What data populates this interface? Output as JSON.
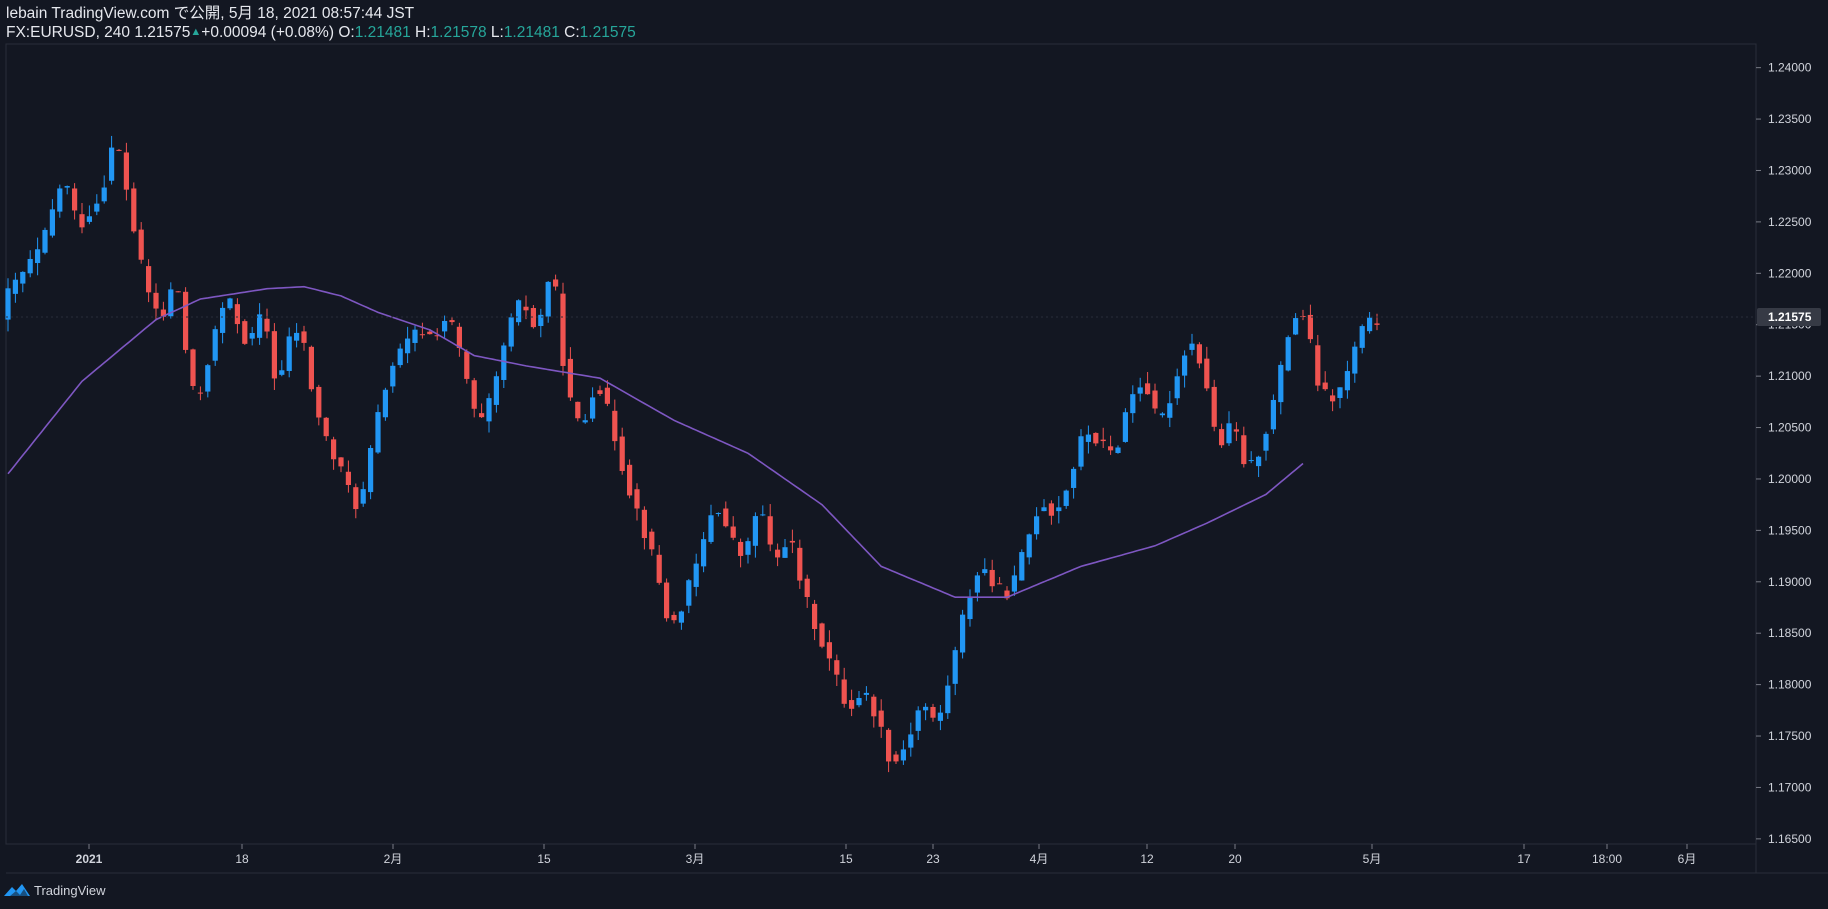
{
  "header": {
    "publisher": "lebain",
    "published_text": "TradingView.com で公開, 5月 18, 2021 08:57:44 JST",
    "symbol": "FX:EURUSD, 240",
    "last": "1.21575",
    "change": "+0.00094 (+0.08%)",
    "o_label": "O:",
    "o_value": "1.21481",
    "h_label": "H:",
    "h_value": "1.21578",
    "l_label": "L:",
    "l_value": "1.21481",
    "c_label": "C:",
    "c_value": "1.21575"
  },
  "footer": {
    "brand": "TradingView"
  },
  "colors": {
    "background": "#131722",
    "up_candle": "#2196f3",
    "down_candle": "#ef5350",
    "moving_average": "#7e57c2",
    "axis_text": "#d1d4dc",
    "price_tag_bg": "#363a45"
  },
  "icons": {
    "footer_logo": "tradingview-logo-icon"
  },
  "chart_data": {
    "type": "candlestick",
    "symbol": "FX:EURUSD",
    "interval": "240",
    "ylim": [
      1.1645,
      1.2423
    ],
    "y_ticks": [
      1.165,
      1.17,
      1.175,
      1.18,
      1.185,
      1.19,
      1.195,
      1.2,
      1.205,
      1.21,
      1.215,
      1.22,
      1.225,
      1.23,
      1.235,
      1.24
    ],
    "y_tick_labels": [
      "1.16500",
      "1.17000",
      "1.17500",
      "1.18000",
      "1.18500",
      "1.19000",
      "1.19500",
      "1.20000",
      "1.20500",
      "1.21000",
      "1.21500",
      "1.22000",
      "1.22500",
      "1.23000",
      "1.23500",
      "1.24000"
    ],
    "x_ticks": [
      "2021",
      "18",
      "2月",
      "15",
      "3月",
      "15",
      "23",
      "4月",
      "12",
      "20",
      "5月",
      "17",
      "18:00",
      "6月"
    ],
    "last_price": 1.21575,
    "last_price_label": "1.21575",
    "price_path": [
      [
        0,
        1.2175
      ],
      [
        5,
        1.2225
      ],
      [
        8,
        1.2295
      ],
      [
        10,
        1.2245
      ],
      [
        13,
        1.2275
      ],
      [
        15,
        1.2335
      ],
      [
        17,
        1.2265
      ],
      [
        18,
        1.222
      ],
      [
        20,
        1.2168
      ],
      [
        22,
        1.2155
      ],
      [
        23,
        1.221
      ],
      [
        25,
        1.2098
      ],
      [
        26,
        1.207
      ],
      [
        28,
        1.213
      ],
      [
        30,
        1.2178
      ],
      [
        31,
        1.2162
      ],
      [
        33,
        1.2128
      ],
      [
        35,
        1.2165
      ],
      [
        37,
        1.208
      ],
      [
        38,
        1.213
      ],
      [
        40,
        1.2148
      ],
      [
        42,
        1.207
      ],
      [
        44,
        1.2028
      ],
      [
        46,
        1.2
      ],
      [
        48,
        1.1968
      ],
      [
        50,
        1.2045
      ],
      [
        52,
        1.2105
      ],
      [
        54,
        1.2128
      ],
      [
        56,
        1.2145
      ],
      [
        58,
        1.2138
      ],
      [
        60,
        1.216
      ],
      [
        62,
        1.2112
      ],
      [
        64,
        1.2048
      ],
      [
        66,
        1.208
      ],
      [
        68,
        1.2145
      ],
      [
        70,
        1.2175
      ],
      [
        72,
        1.214
      ],
      [
        74,
        1.2212
      ],
      [
        76,
        1.2085
      ],
      [
        78,
        1.2045
      ],
      [
        80,
        1.21
      ],
      [
        82,
        1.2055
      ],
      [
        84,
        1.2
      ],
      [
        86,
        1.196
      ],
      [
        88,
        1.1915
      ],
      [
        90,
        1.1852
      ],
      [
        92,
        1.1885
      ],
      [
        94,
        1.1925
      ],
      [
        96,
        1.198
      ],
      [
        98,
        1.1945
      ],
      [
        100,
        1.192
      ],
      [
        102,
        1.198
      ],
      [
        104,
        1.1915
      ],
      [
        106,
        1.1948
      ],
      [
        108,
        1.1888
      ],
      [
        110,
        1.185
      ],
      [
        112,
        1.1815
      ],
      [
        114,
        1.1775
      ],
      [
        116,
        1.1795
      ],
      [
        118,
        1.1768
      ],
      [
        120,
        1.172
      ],
      [
        122,
        1.1745
      ],
      [
        124,
        1.1785
      ],
      [
        126,
        1.1758
      ],
      [
        128,
        1.1815
      ],
      [
        130,
        1.188
      ],
      [
        132,
        1.1918
      ],
      [
        134,
        1.1892
      ],
      [
        136,
        1.189
      ],
      [
        138,
        1.1935
      ],
      [
        140,
        1.198
      ],
      [
        142,
        1.1965
      ],
      [
        144,
        1.2
      ],
      [
        146,
        1.2048
      ],
      [
        148,
        1.2035
      ],
      [
        150,
        1.2022
      ],
      [
        152,
        1.2078
      ],
      [
        154,
        1.2098
      ],
      [
        156,
        1.205
      ],
      [
        158,
        1.2088
      ],
      [
        160,
        1.2138
      ],
      [
        162,
        1.211
      ],
      [
        164,
        1.2028
      ],
      [
        166,
        1.2055
      ],
      [
        168,
        1.2005
      ],
      [
        170,
        1.2035
      ],
      [
        172,
        1.2088
      ],
      [
        174,
        1.2158
      ],
      [
        176,
        1.216
      ],
      [
        177,
        1.21
      ],
      [
        179,
        1.2075
      ],
      [
        181,
        1.209
      ],
      [
        183,
        1.214
      ],
      [
        185,
        1.2155
      ]
    ],
    "moving_average": {
      "values": [
        [
          0,
          1.2005
        ],
        [
          10,
          1.2095
        ],
        [
          20,
          1.2155
        ],
        [
          26,
          1.2175
        ],
        [
          35,
          1.2185
        ],
        [
          40,
          1.2187
        ],
        [
          45,
          1.2178
        ],
        [
          50,
          1.2162
        ],
        [
          57,
          1.2145
        ],
        [
          63,
          1.212
        ],
        [
          70,
          1.211
        ],
        [
          80,
          1.2098
        ],
        [
          90,
          1.2057
        ],
        [
          100,
          1.2025
        ],
        [
          110,
          1.1975
        ],
        [
          118,
          1.1915
        ],
        [
          128,
          1.1885
        ],
        [
          135,
          1.1885
        ],
        [
          145,
          1.1915
        ],
        [
          155,
          1.1935
        ],
        [
          162,
          1.1957
        ],
        [
          170,
          1.1985
        ],
        [
          175,
          1.2015
        ]
      ]
    }
  }
}
